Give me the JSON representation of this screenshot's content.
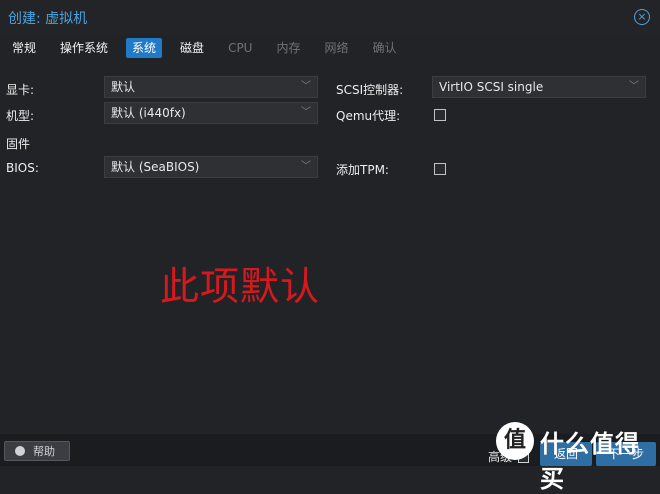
{
  "window": {
    "title": "创建: 虚拟机"
  },
  "tabs": [
    {
      "label": "常规",
      "state": "normal"
    },
    {
      "label": "操作系统",
      "state": "normal"
    },
    {
      "label": "系统",
      "state": "active"
    },
    {
      "label": "磁盘",
      "state": "normal"
    },
    {
      "label": "CPU",
      "state": "disabled"
    },
    {
      "label": "内存",
      "state": "disabled"
    },
    {
      "label": "网络",
      "state": "disabled"
    },
    {
      "label": "确认",
      "state": "disabled"
    }
  ],
  "form": {
    "graphics_card": {
      "label": "显卡:",
      "value": "默认"
    },
    "machine": {
      "label": "机型:",
      "value": "默认 (i440fx)"
    },
    "firmware": {
      "label": "固件"
    },
    "bios": {
      "label": "BIOS:",
      "value": "默认 (SeaBIOS)"
    },
    "scsi_controller": {
      "label": "SCSI控制器:",
      "value": "VirtIO SCSI single"
    },
    "qemu_agent": {
      "label": "Qemu代理:",
      "checked": false
    },
    "tpm": {
      "label": "添加TPM:",
      "checked": false
    }
  },
  "annotation": {
    "text": "此项默认",
    "color": "#d7191d"
  },
  "footer": {
    "help_label": "帮助",
    "advanced_label": "高级",
    "advanced_checked": false,
    "back_label": "返回",
    "next_label": "下一步"
  },
  "watermark": {
    "icon_text": "值",
    "text": "什么值得买"
  },
  "colors": {
    "accent": "#1f7ac7",
    "title": "#4aa3df",
    "background": "#222326",
    "annotation": "#d7191d"
  },
  "icons": {
    "close": "close-circle-icon",
    "chevron": "chevron-down-icon",
    "help": "help-circle-icon"
  }
}
